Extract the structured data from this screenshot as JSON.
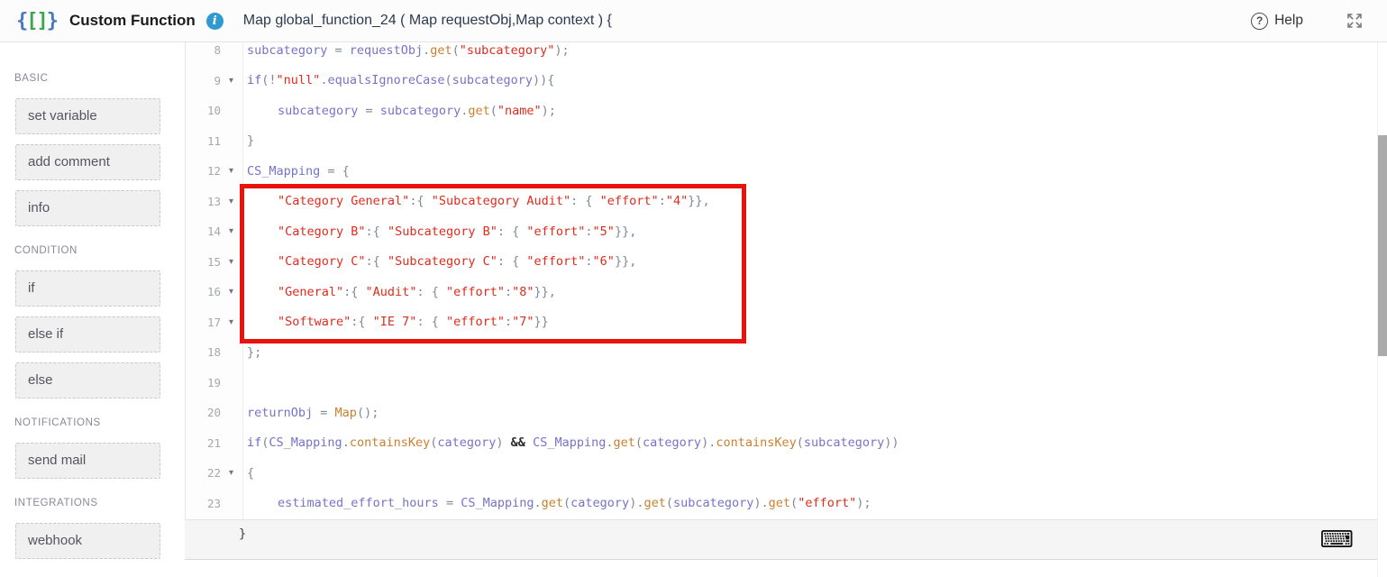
{
  "header": {
    "app_title": "Custom Function",
    "signature": "Map global_function_24 ( Map requestObj,Map context ) {",
    "help_label": "Help"
  },
  "sidebar": {
    "sections": [
      {
        "label": "BASIC",
        "items": [
          "set variable",
          "add comment",
          "info"
        ]
      },
      {
        "label": "CONDITION",
        "items": [
          "if",
          "else if",
          "else"
        ]
      },
      {
        "label": "NOTIFICATIONS",
        "items": [
          "send mail"
        ]
      },
      {
        "label": "INTEGRATIONS",
        "items": [
          "webhook"
        ]
      }
    ]
  },
  "editor": {
    "lines": [
      {
        "num": "8",
        "fold": false,
        "indent": 0,
        "tokens": [
          [
            "subcategory",
            "v"
          ],
          [
            " = ",
            "p"
          ],
          [
            "requestObj",
            "v"
          ],
          [
            ".",
            "p"
          ],
          [
            "get",
            "f"
          ],
          [
            "(",
            "p"
          ],
          [
            "\"subcategory\"",
            "s"
          ],
          [
            ");",
            "p"
          ]
        ]
      },
      {
        "num": "9",
        "fold": true,
        "indent": 0,
        "tokens": [
          [
            "if",
            "k"
          ],
          [
            "(!",
            "p"
          ],
          [
            "\"null\"",
            "s"
          ],
          [
            ".",
            "p"
          ],
          [
            "equalsIgnoreCase",
            "v"
          ],
          [
            "(",
            "p"
          ],
          [
            "subcategory",
            "v"
          ],
          [
            ")){",
            "p"
          ]
        ]
      },
      {
        "num": "10",
        "fold": false,
        "indent": 1,
        "tokens": [
          [
            "subcategory",
            "v"
          ],
          [
            " = ",
            "p"
          ],
          [
            "subcategory",
            "v"
          ],
          [
            ".",
            "p"
          ],
          [
            "get",
            "f"
          ],
          [
            "(",
            "p"
          ],
          [
            "\"name\"",
            "s"
          ],
          [
            ");",
            "p"
          ]
        ]
      },
      {
        "num": "11",
        "fold": false,
        "indent": 0,
        "tokens": [
          [
            "}",
            "p"
          ]
        ]
      },
      {
        "num": "12",
        "fold": true,
        "indent": 0,
        "tokens": [
          [
            "CS_Mapping",
            "v"
          ],
          [
            " = {",
            "p"
          ]
        ]
      },
      {
        "num": "13",
        "fold": true,
        "indent": 1,
        "tokens": [
          [
            "\"Category General\"",
            "s"
          ],
          [
            ":{ ",
            "p"
          ],
          [
            "\"Subcategory Audit\"",
            "s"
          ],
          [
            ": { ",
            "p"
          ],
          [
            "\"effort\"",
            "s"
          ],
          [
            ":",
            "p"
          ],
          [
            "\"4\"",
            "s"
          ],
          [
            "}},",
            "p"
          ]
        ]
      },
      {
        "num": "14",
        "fold": true,
        "indent": 1,
        "tokens": [
          [
            "\"Category B\"",
            "s"
          ],
          [
            ":{ ",
            "p"
          ],
          [
            "\"Subcategory B\"",
            "s"
          ],
          [
            ": { ",
            "p"
          ],
          [
            "\"effort\"",
            "s"
          ],
          [
            ":",
            "p"
          ],
          [
            "\"5\"",
            "s"
          ],
          [
            "}},",
            "p"
          ]
        ]
      },
      {
        "num": "15",
        "fold": true,
        "indent": 1,
        "tokens": [
          [
            "\"Category C\"",
            "s"
          ],
          [
            ":{ ",
            "p"
          ],
          [
            "\"Subcategory C\"",
            "s"
          ],
          [
            ": { ",
            "p"
          ],
          [
            "\"effort\"",
            "s"
          ],
          [
            ":",
            "p"
          ],
          [
            "\"6\"",
            "s"
          ],
          [
            "}},",
            "p"
          ]
        ]
      },
      {
        "num": "16",
        "fold": true,
        "indent": 1,
        "tokens": [
          [
            "\"General\"",
            "s"
          ],
          [
            ":{ ",
            "p"
          ],
          [
            "\"Audit\"",
            "s"
          ],
          [
            ": { ",
            "p"
          ],
          [
            "\"effort\"",
            "s"
          ],
          [
            ":",
            "p"
          ],
          [
            "\"8\"",
            "s"
          ],
          [
            "}},",
            "p"
          ]
        ]
      },
      {
        "num": "17",
        "fold": true,
        "indent": 1,
        "tokens": [
          [
            "\"Software\"",
            "s"
          ],
          [
            ":{ ",
            "p"
          ],
          [
            "\"IE 7\"",
            "s"
          ],
          [
            ": { ",
            "p"
          ],
          [
            "\"effort\"",
            "s"
          ],
          [
            ":",
            "p"
          ],
          [
            "\"7\"",
            "s"
          ],
          [
            "}}",
            "p"
          ]
        ]
      },
      {
        "num": "18",
        "fold": false,
        "indent": 0,
        "tokens": [
          [
            "};",
            "p"
          ]
        ]
      },
      {
        "num": "19",
        "fold": false,
        "indent": 0,
        "tokens": []
      },
      {
        "num": "20",
        "fold": false,
        "indent": 0,
        "tokens": [
          [
            "returnObj",
            "v"
          ],
          [
            " = ",
            "p"
          ],
          [
            "Map",
            "f"
          ],
          [
            "();",
            "p"
          ]
        ]
      },
      {
        "num": "21",
        "fold": false,
        "indent": 0,
        "tokens": [
          [
            "if",
            "k"
          ],
          [
            "(",
            "p"
          ],
          [
            "CS_Mapping",
            "v"
          ],
          [
            ".",
            "p"
          ],
          [
            "containsKey",
            "f"
          ],
          [
            "(",
            "p"
          ],
          [
            "category",
            "v"
          ],
          [
            ") ",
            "p"
          ],
          [
            "&&",
            "b"
          ],
          [
            " ",
            "p"
          ],
          [
            "CS_Mapping",
            "v"
          ],
          [
            ".",
            "p"
          ],
          [
            "get",
            "f"
          ],
          [
            "(",
            "p"
          ],
          [
            "category",
            "v"
          ],
          [
            ").",
            "p"
          ],
          [
            "containsKey",
            "f"
          ],
          [
            "(",
            "p"
          ],
          [
            "subcategory",
            "v"
          ],
          [
            "))",
            "p"
          ]
        ]
      },
      {
        "num": "22",
        "fold": true,
        "indent": 0,
        "tokens": [
          [
            "{",
            "p"
          ]
        ]
      },
      {
        "num": "23",
        "fold": false,
        "indent": 1,
        "tokens": [
          [
            "estimated_effort_hours",
            "v"
          ],
          [
            " = ",
            "p"
          ],
          [
            "CS_Mapping",
            "v"
          ],
          [
            ".",
            "p"
          ],
          [
            "get",
            "f"
          ],
          [
            "(",
            "p"
          ],
          [
            "category",
            "v"
          ],
          [
            ").",
            "p"
          ],
          [
            "get",
            "f"
          ],
          [
            "(",
            "p"
          ],
          [
            "subcategory",
            "v"
          ],
          [
            ").",
            "p"
          ],
          [
            "get",
            "f"
          ],
          [
            "(",
            "p"
          ],
          [
            "\"effort\"",
            "s"
          ],
          [
            ");",
            "p"
          ]
        ]
      }
    ],
    "footer_brace": "}"
  },
  "colors": {
    "accent_blue": "#2f9ad2",
    "logo_blue": "#4878c0",
    "logo_green": "#3aa84c",
    "variable_purple": "#7673c8",
    "string_red": "#e02b1d",
    "function_orange": "#c9802f",
    "punctuation_gray": "#7e8a96",
    "highlight_box_red": "#e8130c",
    "scroll_thumb_gray": "#ababab"
  }
}
